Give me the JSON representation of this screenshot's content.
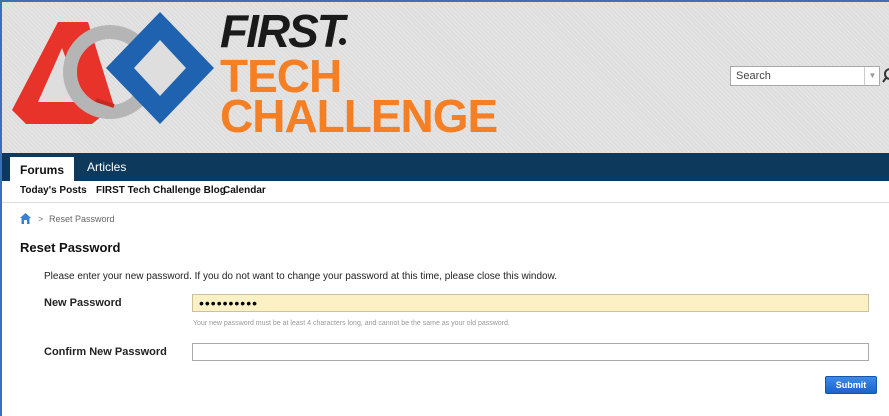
{
  "header": {
    "logo_line1": "FIRST",
    "logo_line2": "TECH",
    "logo_line3": "CHALLENGE",
    "search_placeholder": "Search",
    "search_dropdown_icon": "chevron-down-icon",
    "search_button_icon": "search-icon"
  },
  "nav": {
    "tabs": [
      {
        "label": "Forums",
        "active": true
      },
      {
        "label": "Articles",
        "active": false
      }
    ]
  },
  "subnav": {
    "items": [
      {
        "label": "Today's Posts"
      },
      {
        "label": "FIRST Tech Challenge Blog"
      },
      {
        "label": "Calendar"
      }
    ]
  },
  "breadcrumb": {
    "home_icon": "home-icon",
    "separator": ">",
    "current": "Reset Password"
  },
  "page": {
    "title": "Reset Password",
    "instructions": "Please enter your new password. If you do not want to change your password at this time, please close this window.",
    "new_password_label": "New Password",
    "new_password_value": "••••••••••",
    "new_password_hint": "Your new password must be at least 4 characters long, and cannot be the same as your old password.",
    "confirm_password_label": "Confirm New Password",
    "confirm_password_value": "",
    "submit_label": "Submit"
  },
  "colors": {
    "navbar": "#0d3a5c",
    "logo_orange": "#f47f24",
    "logo_red": "#e8332a",
    "logo_blue": "#1e62b0",
    "password_field_bg": "#fbf1c4",
    "submit_button": "#2a74d6"
  }
}
